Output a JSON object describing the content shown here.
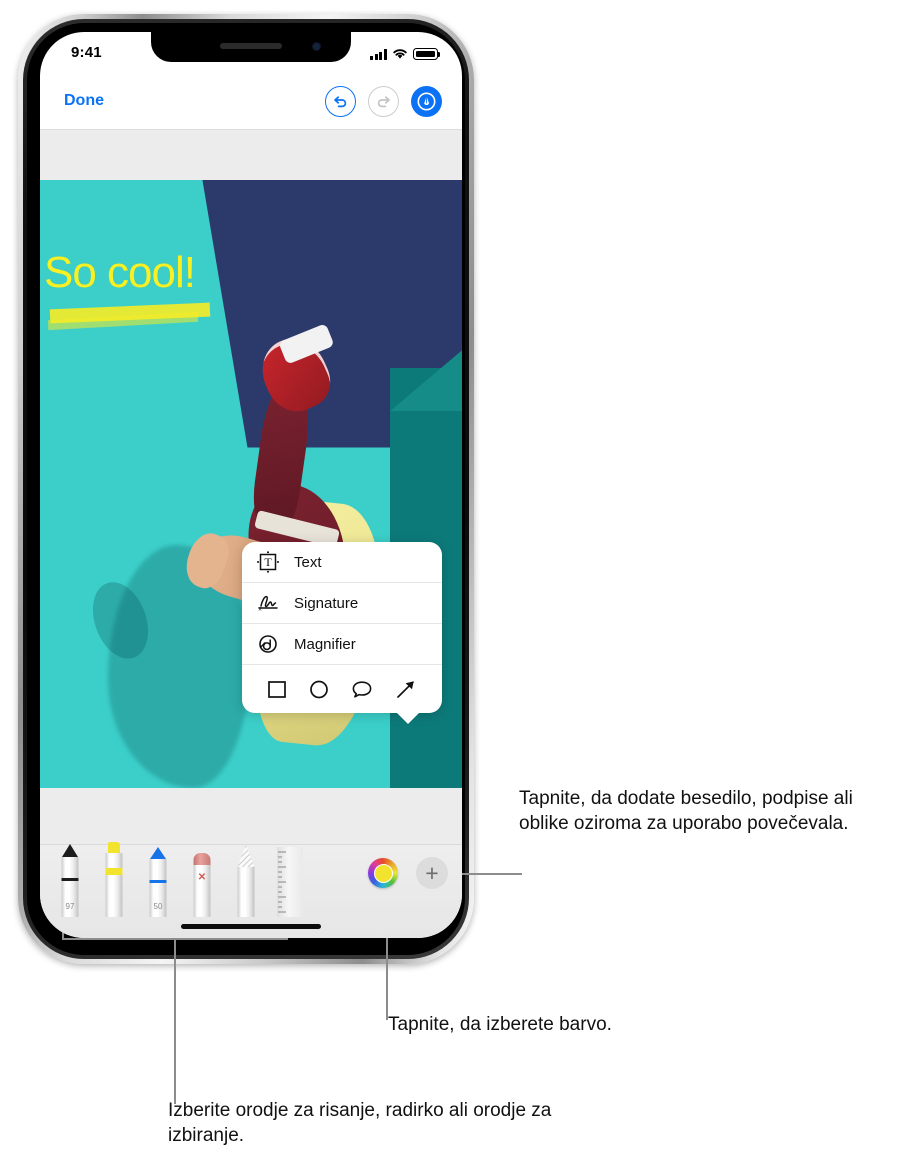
{
  "status_bar": {
    "time": "9:41",
    "signal_icon": "cellular-signal-icon",
    "wifi_icon": "wifi-icon",
    "battery_icon": "battery-icon"
  },
  "nav_bar": {
    "done_label": "Done",
    "undo_icon": "undo-icon",
    "redo_icon": "redo-icon",
    "markup_icon": "markup-pen-icon"
  },
  "photo": {
    "annotation_text": "So cool!",
    "annotation_color": "#f7f024",
    "highlighter_color": "#f3eb28"
  },
  "popup_menu": {
    "items": [
      {
        "label": "Text",
        "icon": "text-box-icon"
      },
      {
        "label": "Signature",
        "icon": "signature-icon"
      },
      {
        "label": "Magnifier",
        "icon": "magnifier-icon"
      }
    ],
    "shapes": [
      {
        "name": "square-shape-icon"
      },
      {
        "name": "circle-shape-icon"
      },
      {
        "name": "speech-bubble-shape-icon"
      },
      {
        "name": "arrow-shape-icon"
      }
    ]
  },
  "toolbar": {
    "tools": [
      {
        "name": "pen-tool",
        "number": "97",
        "color": "#1c1c1c"
      },
      {
        "name": "highlighter-tool",
        "number": "",
        "color": "#f2e32e"
      },
      {
        "name": "marker-tool",
        "number": "50",
        "color": "#1673e8"
      },
      {
        "name": "eraser-tool",
        "number": "",
        "color": "#d98a86"
      },
      {
        "name": "lasso-tool",
        "number": "",
        "color": "#bdbdbd"
      },
      {
        "name": "ruler-tool",
        "number": "",
        "color": "#e4e4e4"
      }
    ],
    "color_well": {
      "name": "color-picker-button",
      "selected_color": "#f2e32e"
    },
    "add_button": {
      "name": "add-tool-button",
      "label": "+"
    }
  },
  "callouts": {
    "menu": "Tapnite, da dodate besedilo, podpise ali oblike oziroma za uporabo povečevala.",
    "color": "Tapnite, da izberete barvo.",
    "tools": "Izberite orodje za risanje, radirko ali orodje za izbiranje."
  },
  "colors": {
    "accent_blue": "#0b72f5",
    "toolbar_bg": "#ececec",
    "leader_line": "#8c8c8c"
  }
}
